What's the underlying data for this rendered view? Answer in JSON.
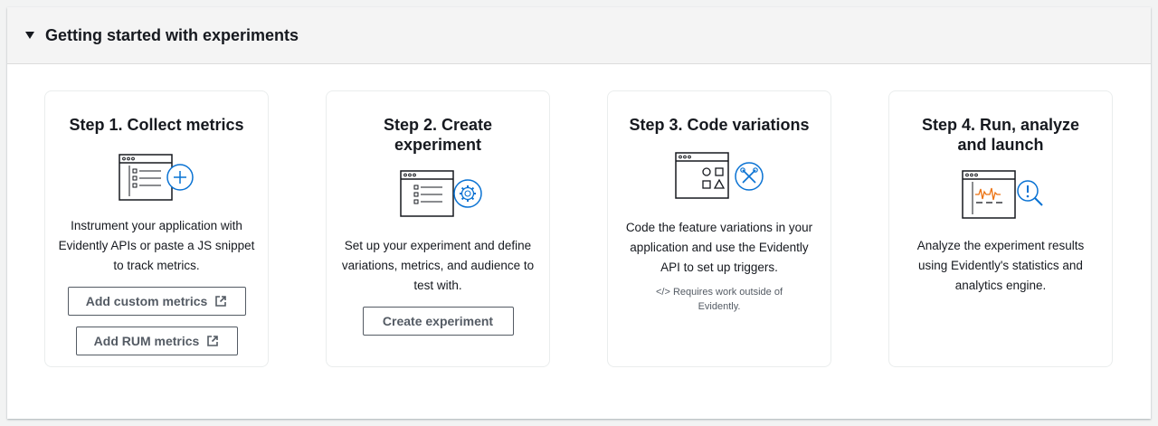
{
  "panel": {
    "title": "Getting started with experiments"
  },
  "steps": [
    {
      "title": "Step 1. Collect metrics",
      "description": "Instrument your application with Evidently APIs or paste a JS snippet to track metrics.",
      "buttons": [
        "Add custom metrics",
        "Add RUM metrics"
      ],
      "icon": "metrics-plus-icon"
    },
    {
      "title": "Step 2. Create experiment",
      "description": "Set up your experiment and define variations, metrics, and audience to test with.",
      "buttons": [
        "Create experiment"
      ],
      "icon": "experiment-gear-icon"
    },
    {
      "title": "Step 3. Code variations",
      "description": "Code the feature variations in your application and use the Evidently API to set up triggers.",
      "note": "</> Requires work outside of Evidently.",
      "icon": "code-tools-icon"
    },
    {
      "title": "Step 4. Run, analyze and launch",
      "description": "Analyze the experiment results using Evidently's statistics and analytics engine.",
      "icon": "analyze-search-icon"
    }
  ],
  "colors": {
    "accent": "#0972d3",
    "wave": "#ec7211",
    "text": "#16191f",
    "muted": "#545b64"
  }
}
